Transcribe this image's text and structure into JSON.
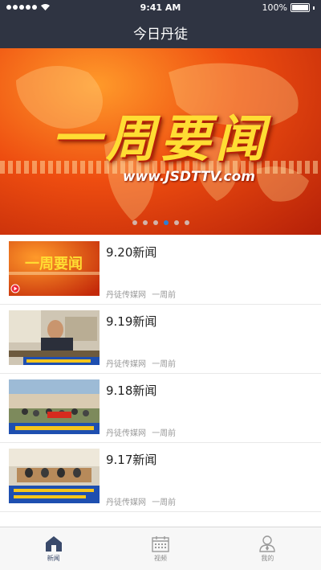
{
  "status_bar": {
    "time": "9:41 AM",
    "battery": "100%"
  },
  "nav": {
    "title": "今日丹徒"
  },
  "banner": {
    "headline": "一周要闻",
    "url": "www.JSDTTV.com",
    "page_count": 6,
    "active_page": 4
  },
  "news": [
    {
      "title": "9.20新闻",
      "source": "丹徒传媒网",
      "time": "一周前"
    },
    {
      "title": "9.19新闻",
      "source": "丹徒传媒网",
      "time": "一周前"
    },
    {
      "title": "9.18新闻",
      "source": "丹徒传媒网",
      "time": "一周前"
    },
    {
      "title": "9.17新闻",
      "source": "丹徒传媒网",
      "time": "一周前"
    }
  ],
  "tabbar": {
    "tabs": [
      {
        "label": "新闻",
        "icon": "home-icon",
        "active": true
      },
      {
        "label": "视频",
        "icon": "calendar-icon",
        "active": false
      },
      {
        "label": "我的",
        "icon": "user-icon",
        "active": false
      }
    ]
  },
  "colors": {
    "nav_bg": "#2f3442",
    "banner_orange": "#ee4d10",
    "active_dot": "#2d7fd4",
    "tab_active": "#3a4a6b"
  }
}
